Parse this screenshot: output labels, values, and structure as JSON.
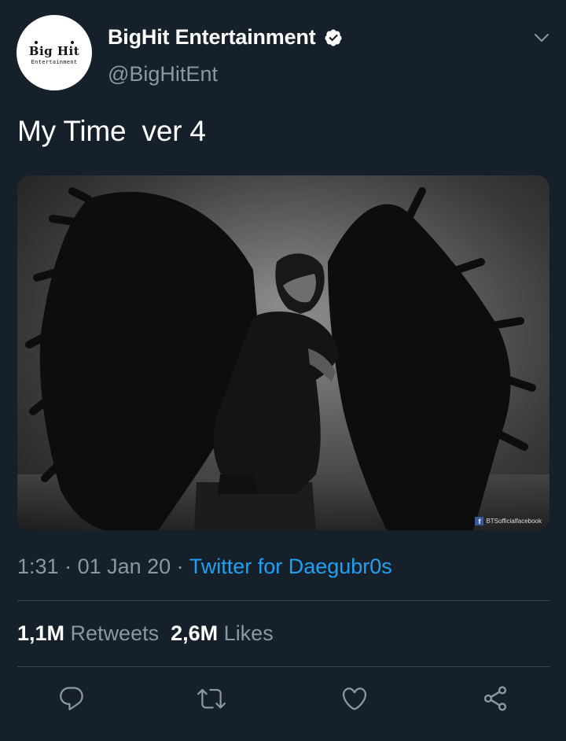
{
  "account": {
    "avatar_logo_main": "Big Hit",
    "avatar_logo_sub": "Entertainment",
    "display_name": "BigHit Entertainment",
    "handle": "@BigHitEnt",
    "verified": true
  },
  "tweet": {
    "text": "My Time  ver 4",
    "media_watermark": "BTSofficialfacebook"
  },
  "meta": {
    "time": "1:31",
    "sep1": " · ",
    "date": "01 Jan 20",
    "sep2": " · ",
    "source": "Twitter for Daegubr0s"
  },
  "stats": {
    "retweets_count": "1,1M",
    "retweets_label": "Retweets",
    "likes_count": "2,6M",
    "likes_label": "Likes"
  },
  "actions": {
    "icons": [
      "reply-icon",
      "retweet-icon",
      "like-icon",
      "share-icon"
    ]
  },
  "colors": {
    "background": "#15202b",
    "text": "#ffffff",
    "secondary": "#8899a6",
    "link": "#1da1f2",
    "divider": "#38444d"
  }
}
